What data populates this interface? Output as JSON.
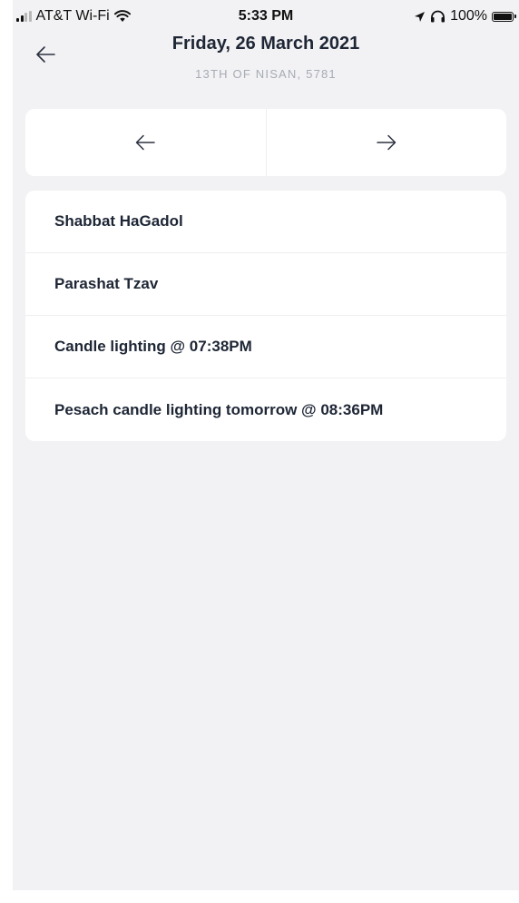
{
  "status_bar": {
    "carrier": "AT&T Wi-Fi",
    "time": "5:33 PM",
    "battery": "100%",
    "battery_level": 1.0,
    "signal_bars_active": 2,
    "signal_bars_total": 4
  },
  "header": {
    "back_icon": "arrow-left-icon",
    "title": "Friday, 26 March 2021",
    "subtitle": "13TH OF NISAN, 5781"
  },
  "day_nav": {
    "prev_icon": "arrow-left-icon",
    "next_icon": "arrow-right-icon"
  },
  "events": [
    {
      "label": "Shabbat HaGadol"
    },
    {
      "label": "Parashat Tzav"
    },
    {
      "label": "Candle lighting @ 07:38PM"
    },
    {
      "label": "Pesach candle lighting tomorrow @ 08:36PM"
    }
  ],
  "colors": {
    "background": "#f2f2f4",
    "card": "#ffffff",
    "text_primary": "#1e2635",
    "text_secondary": "#a6abb4"
  }
}
